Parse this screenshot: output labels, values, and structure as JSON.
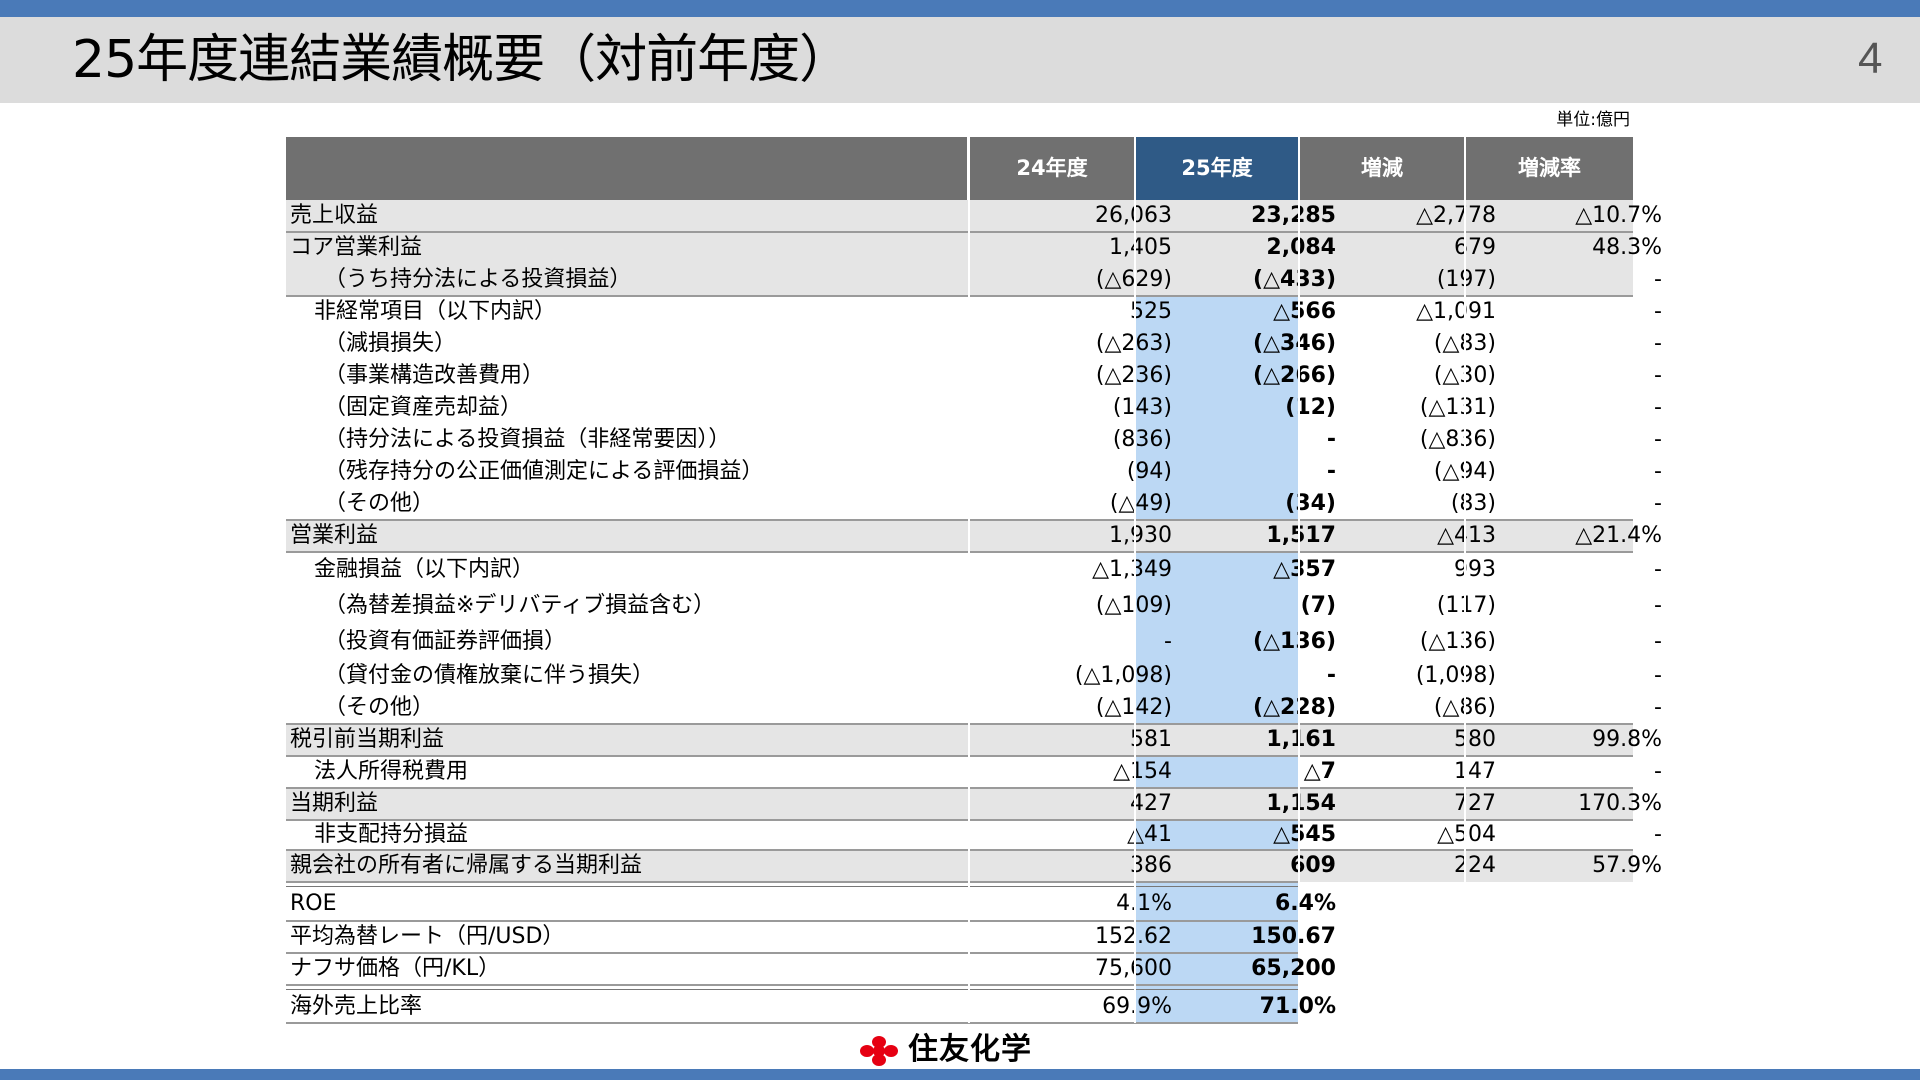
{
  "slide": {
    "title": "25年度連結業績概要（対前年度）",
    "page_number": "4",
    "unit_note": "単位:億円",
    "company": "住友化学"
  },
  "table": {
    "columns": [
      "",
      "24年度",
      "25年度",
      "増減",
      "増減率"
    ],
    "rows": [
      {
        "label": "売上収益",
        "fy24": "26,063",
        "fy25": "23,285",
        "diff": "△2,778",
        "rate": "△10.7%"
      },
      {
        "label": "コア営業利益",
        "fy24": "1,405",
        "fy25": "2,084",
        "diff": "679",
        "rate": "48.3%"
      },
      {
        "label": "（うち持分法による投資損益）",
        "fy24": "(△629)",
        "fy25": "(△433)",
        "diff": "(197)",
        "rate": "-"
      },
      {
        "label": "非経常項目（以下内訳）",
        "fy24": "525",
        "fy25": "△566",
        "diff": "△1,091",
        "rate": "-"
      },
      {
        "label": "（減損損失）",
        "fy24": "(△263)",
        "fy25": "(△346)",
        "diff": "(△83)",
        "rate": "-"
      },
      {
        "label": "（事業構造改善費用）",
        "fy24": "(△236)",
        "fy25": "(△266)",
        "diff": "(△30)",
        "rate": "-"
      },
      {
        "label": "（固定資産売却益）",
        "fy24": "(143)",
        "fy25": "(12)",
        "diff": "(△131)",
        "rate": "-"
      },
      {
        "label": "（持分法による投資損益（非経常要因））",
        "fy24": "(836)",
        "fy25": "-",
        "diff": "(△836)",
        "rate": "-"
      },
      {
        "label": "（残存持分の公正価値測定による評価損益）",
        "fy24": "(94)",
        "fy25": "-",
        "diff": "(△94)",
        "rate": "-"
      },
      {
        "label": "（その他）",
        "fy24": "(△49)",
        "fy25": "(34)",
        "diff": "(83)",
        "rate": "-"
      },
      {
        "label": "営業利益",
        "fy24": "1,930",
        "fy25": "1,517",
        "diff": "△413",
        "rate": "△21.4%"
      },
      {
        "label": "金融損益（以下内訳）",
        "fy24": "△1,349",
        "fy25": "△357",
        "diff": "993",
        "rate": "-"
      },
      {
        "label": "（為替差損益※デリバティブ損益含む）",
        "fy24": "(△109)",
        "fy25": "(7)",
        "diff": "(117)",
        "rate": "-"
      },
      {
        "label": "（投資有価証券評価損）",
        "fy24": "-",
        "fy25": "(△136)",
        "diff": "(△136)",
        "rate": "-"
      },
      {
        "label": "（貸付金の債権放棄に伴う損失）",
        "fy24": "(△1,098)",
        "fy25": "-",
        "diff": "(1,098)",
        "rate": "-"
      },
      {
        "label": "（その他）",
        "fy24": "(△142)",
        "fy25": "(△228)",
        "diff": "(△86)",
        "rate": "-"
      },
      {
        "label": "税引前当期利益",
        "fy24": "581",
        "fy25": "1,161",
        "diff": "580",
        "rate": "99.8%"
      },
      {
        "label": "法人所得税費用",
        "fy24": "△154",
        "fy25": "△7",
        "diff": "147",
        "rate": "-"
      },
      {
        "label": "当期利益",
        "fy24": "427",
        "fy25": "1,154",
        "diff": "727",
        "rate": "170.3%"
      },
      {
        "label": "非支配持分損益",
        "fy24": "△41",
        "fy25": "△545",
        "diff": "△504",
        "rate": "-"
      },
      {
        "label": "親会社の所有者に帰属する当期利益",
        "fy24": "386",
        "fy25": "609",
        "diff": "224",
        "rate": "57.9%"
      },
      {
        "label": "ROE",
        "fy24": "4.1%",
        "fy25": "6.4%",
        "diff": "",
        "rate": ""
      },
      {
        "label": "平均為替レート（円/USD）",
        "fy24": "152.62",
        "fy25": "150.67",
        "diff": "",
        "rate": ""
      },
      {
        "label": "ナフサ価格（円/KL）",
        "fy24": "75,600",
        "fy25": "65,200",
        "diff": "",
        "rate": ""
      },
      {
        "label": "海外売上比率",
        "fy24": "69.9%",
        "fy25": "71.0%",
        "diff": "",
        "rate": ""
      }
    ]
  },
  "colors": {
    "top_bar": "#4a7ab8",
    "title_bg": "#dcdcdc",
    "header_bg": "#707070",
    "header_highlight_bg": "#2f5a86",
    "highlight_column_bg": "#bcd8f4",
    "subtotal_row_bg": "#e5e5e5",
    "logo_red": "#e60012"
  }
}
